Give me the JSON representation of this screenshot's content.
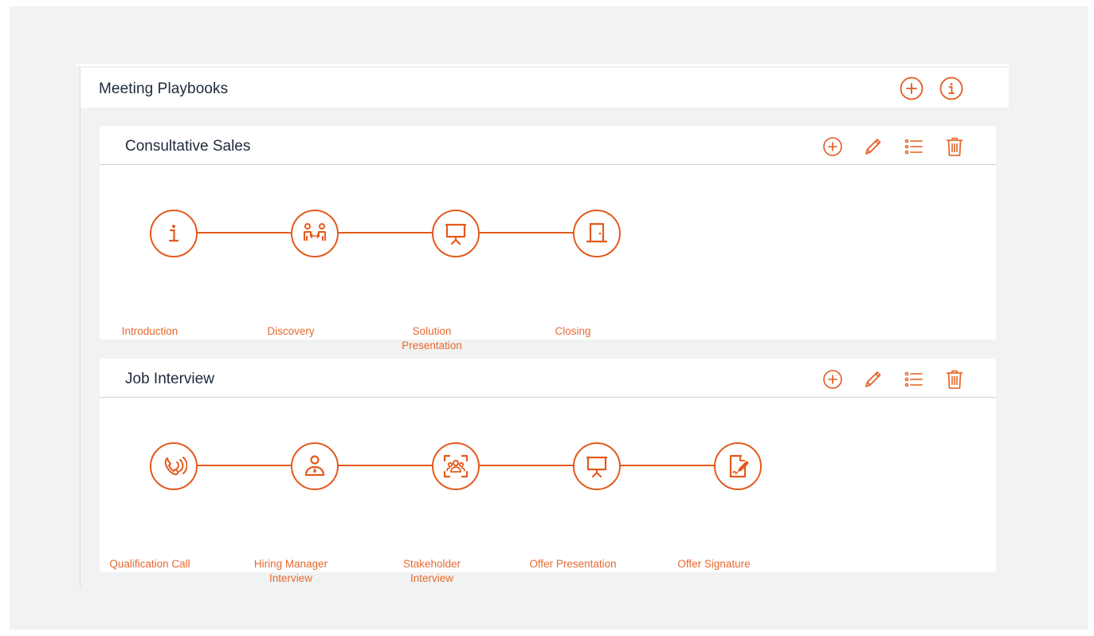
{
  "panel": {
    "title": "Meeting Playbooks",
    "actions": [
      "plus-circle-icon",
      "info-circle-icon"
    ]
  },
  "colors": {
    "accent": "#e35a1d",
    "label": "#e8692f",
    "title": "#1e2a3b",
    "background": "#f1f2f2"
  },
  "playbooks": [
    {
      "title": "Consultative Sales",
      "actions": [
        "plus-circle-icon",
        "pencil-icon",
        "list-icon",
        "trash-icon"
      ],
      "steps": [
        {
          "icon": "info-icon",
          "label_lines": [
            "Introduction"
          ]
        },
        {
          "icon": "people-exchange-icon",
          "label_lines": [
            "Discovery"
          ]
        },
        {
          "icon": "presentation-board-icon",
          "label_lines": [
            "Solution",
            "Presentation"
          ]
        },
        {
          "icon": "door-icon",
          "label_lines": [
            "Closing"
          ]
        }
      ]
    },
    {
      "title": "Job Interview",
      "actions": [
        "plus-circle-icon",
        "pencil-icon",
        "list-icon",
        "trash-icon"
      ],
      "steps": [
        {
          "icon": "phone-call-icon",
          "label_lines": [
            "Qualification Call"
          ]
        },
        {
          "icon": "manager-icon",
          "label_lines": [
            "Hiring Manager",
            "Interview"
          ]
        },
        {
          "icon": "group-focus-icon",
          "label_lines": [
            "Stakeholder",
            "Interview"
          ]
        },
        {
          "icon": "presentation-board-icon",
          "label_lines": [
            "Offer Presentation"
          ]
        },
        {
          "icon": "document-sign-icon",
          "label_lines": [
            "Offer Signature"
          ]
        }
      ]
    }
  ]
}
